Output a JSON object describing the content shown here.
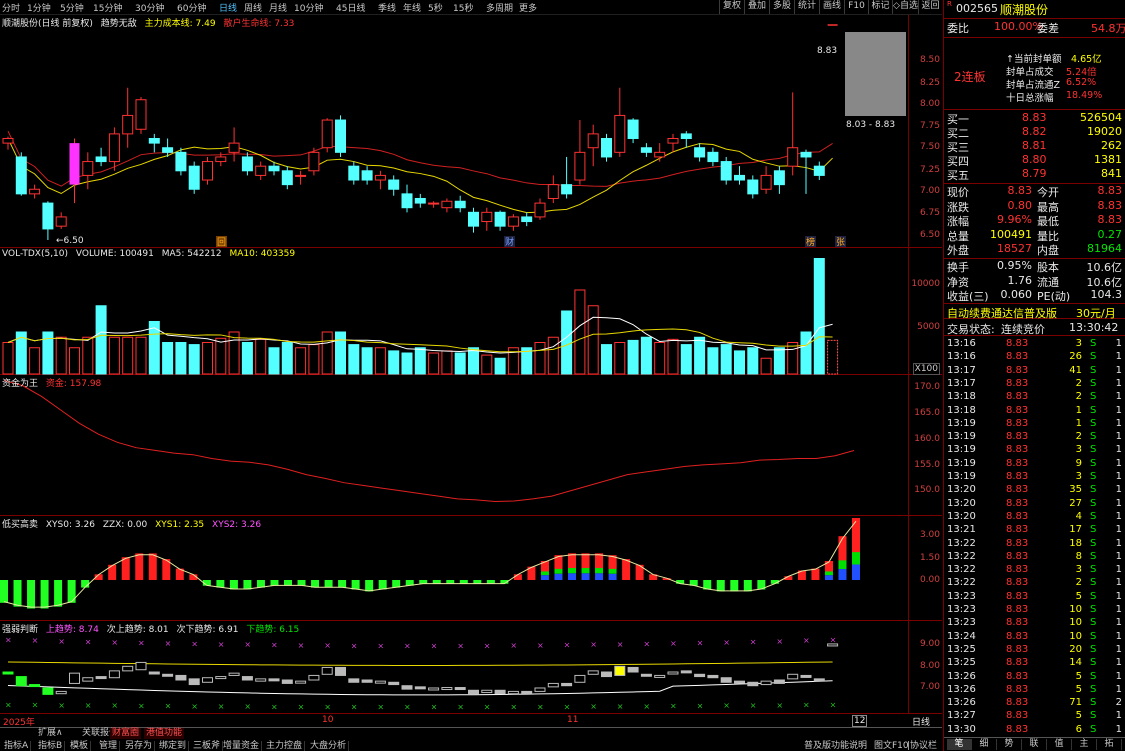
{
  "topbar": {
    "periods": [
      "分时",
      "1分钟",
      "5分钟",
      "15分钟",
      "30分钟",
      "60分钟",
      "日线",
      "周线",
      "月线",
      "10分钟",
      "45日线",
      "季线",
      "年线",
      "5秒",
      "15秒",
      "多周期",
      "更多"
    ],
    "active_period": "日线",
    "buttons": [
      "复权",
      "叠加",
      "多股",
      "统计",
      "画线",
      "F10",
      "标记",
      "◇自选",
      "返回"
    ]
  },
  "main": {
    "title": "顺潮股份(日线 前复权)",
    "indicator": "趋势无敌",
    "cost_line": "主力成本线: 7.49",
    "breakeven": "散户生命线: 7.33",
    "y_labels": [
      "8.50",
      "8.25",
      "8.00",
      "7.75",
      "7.50",
      "7.25",
      "7.00",
      "6.75",
      "6.50"
    ],
    "low_label": "6.50",
    "high_label": "8.83",
    "range_label": "8.03 - 8.83",
    "markers": [
      "回",
      "财",
      "榜",
      "张"
    ]
  },
  "volume": {
    "title": "VOL-TDX(5,10)",
    "volume": "VOLUME: 100491",
    "ma5": "MA5: 542212",
    "ma10": "MA10: 403359",
    "y_labels": [
      "10000",
      "5000"
    ],
    "unit": "X100"
  },
  "fund": {
    "title": "资金为王",
    "value": "资金: 157.98",
    "y_labels": [
      "170.0",
      "165.0",
      "160.0",
      "155.0",
      "150.0"
    ]
  },
  "lowbuy": {
    "title": "低买高卖",
    "xys0": "XYS0: 3.26",
    "zzx": "ZZX: 0.00",
    "xys1": "XYS1: 2.35",
    "xys2": "XYS2: 3.26",
    "y_labels": [
      "3.00",
      "1.50",
      "0.00"
    ]
  },
  "strength": {
    "title": "强弱判断",
    "up": "上趋势: 8.74",
    "next_up": "次上趋势: 8.01",
    "next_down": "次下趋势: 6.91",
    "down": "下趋势: 6.15",
    "y_labels": [
      "9.00",
      "8.00",
      "7.00"
    ]
  },
  "xaxis": {
    "labels": [
      "2025年",
      "10",
      "11",
      "12"
    ],
    "period": "日线"
  },
  "bottombar": {
    "tabs_top": [
      "扩展∧",
      "关联报价",
      "财富圈",
      "港值功能"
    ],
    "tabs": [
      "指标A",
      "指标B",
      "模板",
      "管理",
      "另存为",
      "绑定到",
      "三板斧",
      "增量资金",
      "主力控盘",
      "大盘分析"
    ],
    "right_tabs": [
      "普及版功能说明",
      "图文F10",
      "|协议栏"
    ]
  },
  "side": {
    "code": "002565",
    "name": "顺潮股份",
    "ratio_label": "委比",
    "ratio": "100.00%",
    "diff_label": "委差",
    "diff": "54.8万",
    "board": "2连板",
    "seal_lines": [
      {
        "label": "↑当前封单额",
        "value": "4.65亿"
      },
      {
        "label": "封单占成交",
        "value": "5.24倍"
      },
      {
        "label": "封单占流通Z",
        "value": "6.52%"
      },
      {
        "label": "十日总涨幅",
        "value": "18.49%"
      }
    ],
    "bids": [
      {
        "label": "买一",
        "price": "8.83",
        "vol": "526504"
      },
      {
        "label": "买二",
        "price": "8.82",
        "vol": "19020"
      },
      {
        "label": "买三",
        "price": "8.81",
        "vol": "262"
      },
      {
        "label": "买四",
        "price": "8.80",
        "vol": "1381"
      },
      {
        "label": "买五",
        "price": "8.79",
        "vol": "841"
      }
    ],
    "quote": [
      {
        "l1": "现价",
        "v1": "8.83",
        "l2": "今开",
        "v2": "8.83"
      },
      {
        "l1": "涨跌",
        "v1": "0.80",
        "l2": "最高",
        "v2": "8.83"
      },
      {
        "l1": "涨幅",
        "v1": "9.96%",
        "l2": "最低",
        "v2": "8.83"
      },
      {
        "l1": "总量",
        "v1": "100491",
        "l2": "量比",
        "v2": "0.27"
      },
      {
        "l1": "外盘",
        "v1": "18527",
        "l2": "内盘",
        "v2": "81964"
      }
    ],
    "stats": [
      {
        "l1": "换手",
        "v1": "0.95%",
        "l2": "股本",
        "v2": "10.6亿"
      },
      {
        "l1": "净资",
        "v1": "1.76",
        "l2": "流通",
        "v2": "10.6亿"
      },
      {
        "l1": "收益(三)",
        "v1": "0.060",
        "l2": "PE(动)",
        "v2": "104.3"
      }
    ],
    "promo": "自动续费通达信普及版",
    "price_tag": "30元/月",
    "trade_status_label": "交易状态:",
    "trade_status": "连续竞价",
    "trade_time": "13:30:42",
    "ticks": [
      [
        "13:16",
        "8.83",
        "3",
        "S",
        "1"
      ],
      [
        "13:16",
        "8.83",
        "26",
        "S",
        "1"
      ],
      [
        "13:17",
        "8.83",
        "41",
        "S",
        "1"
      ],
      [
        "13:17",
        "8.83",
        "2",
        "S",
        "1"
      ],
      [
        "13:18",
        "8.83",
        "2",
        "S",
        "1"
      ],
      [
        "13:18",
        "8.83",
        "1",
        "S",
        "1"
      ],
      [
        "13:19",
        "8.83",
        "1",
        "S",
        "1"
      ],
      [
        "13:19",
        "8.83",
        "2",
        "S",
        "1"
      ],
      [
        "13:19",
        "8.83",
        "3",
        "S",
        "1"
      ],
      [
        "13:19",
        "8.83",
        "9",
        "S",
        "1"
      ],
      [
        "13:19",
        "8.83",
        "3",
        "S",
        "1"
      ],
      [
        "13:20",
        "8.83",
        "35",
        "S",
        "1"
      ],
      [
        "13:20",
        "8.83",
        "27",
        "S",
        "1"
      ],
      [
        "13:20",
        "8.83",
        "4",
        "S",
        "1"
      ],
      [
        "13:21",
        "8.83",
        "17",
        "S",
        "1"
      ],
      [
        "13:22",
        "8.83",
        "18",
        "S",
        "1"
      ],
      [
        "13:22",
        "8.83",
        "8",
        "S",
        "1"
      ],
      [
        "13:22",
        "8.83",
        "3",
        "S",
        "1"
      ],
      [
        "13:22",
        "8.83",
        "2",
        "S",
        "1"
      ],
      [
        "13:23",
        "8.83",
        "5",
        "S",
        "1"
      ],
      [
        "13:23",
        "8.83",
        "10",
        "S",
        "1"
      ],
      [
        "13:23",
        "8.83",
        "10",
        "S",
        "1"
      ],
      [
        "13:24",
        "8.83",
        "10",
        "S",
        "1"
      ],
      [
        "13:25",
        "8.83",
        "20",
        "S",
        "1"
      ],
      [
        "13:25",
        "8.83",
        "14",
        "S",
        "1"
      ],
      [
        "13:26",
        "8.83",
        "5",
        "S",
        "1"
      ],
      [
        "13:26",
        "8.83",
        "5",
        "S",
        "1"
      ],
      [
        "13:26",
        "8.83",
        "71",
        "S",
        "2"
      ],
      [
        "13:27",
        "8.83",
        "5",
        "S",
        "1"
      ],
      [
        "13:30",
        "8.83",
        "6",
        "S",
        "1"
      ]
    ],
    "bottom_tabs": [
      "笔",
      "细",
      "势",
      "联",
      "值",
      "主",
      "拓"
    ]
  },
  "colors": {
    "up": "#ff3232",
    "down": "#54ffff",
    "panel_border": "#7a0000",
    "bg": "#000000",
    "ma_white": "#ffffff",
    "ma_yellow": "#ffff00"
  },
  "chart_data": {
    "type": "candlestick",
    "ylim": [
      6.5,
      8.83
    ],
    "candles": [
      [
        7.55,
        7.6,
        7.48,
        7.62
      ],
      [
        7.4,
        7.0,
        6.98,
        7.45
      ],
      [
        7.0,
        7.05,
        6.95,
        7.1
      ],
      [
        6.9,
        6.62,
        6.5,
        6.92
      ],
      [
        6.65,
        6.75,
        6.62,
        6.8
      ],
      [
        7.1,
        7.55,
        6.9,
        7.6
      ],
      [
        7.2,
        7.35,
        7.05,
        7.45
      ],
      [
        7.4,
        7.35,
        7.3,
        7.5
      ],
      [
        7.35,
        7.65,
        7.25,
        7.72
      ],
      [
        7.65,
        7.85,
        7.5,
        8.15
      ],
      [
        7.7,
        8.02,
        7.65,
        8.05
      ],
      [
        7.6,
        7.55,
        7.45,
        7.65
      ],
      [
        7.5,
        7.45,
        7.4,
        7.6
      ],
      [
        7.45,
        7.25,
        7.2,
        7.5
      ],
      [
        7.3,
        7.05,
        7.0,
        7.35
      ],
      [
        7.15,
        7.35,
        7.1,
        7.4
      ],
      [
        7.35,
        7.4,
        7.3,
        7.45
      ],
      [
        7.45,
        7.55,
        7.35,
        7.72
      ],
      [
        7.4,
        7.25,
        7.2,
        7.45
      ],
      [
        7.2,
        7.3,
        7.15,
        7.35
      ],
      [
        7.3,
        7.25,
        7.2,
        7.35
      ],
      [
        7.25,
        7.1,
        7.05,
        7.3
      ],
      [
        7.2,
        7.2,
        7.1,
        7.25
      ],
      [
        7.25,
        7.45,
        7.2,
        7.5
      ],
      [
        7.5,
        7.8,
        7.45,
        7.82
      ],
      [
        7.8,
        7.45,
        7.4,
        7.85
      ],
      [
        7.3,
        7.15,
        7.1,
        7.35
      ],
      [
        7.25,
        7.15,
        7.1,
        7.3
      ],
      [
        7.15,
        7.2,
        7.05,
        7.25
      ],
      [
        7.15,
        7.05,
        6.98,
        7.2
      ],
      [
        7.0,
        6.85,
        6.8,
        7.1
      ],
      [
        6.95,
        6.9,
        6.85,
        7.0
      ],
      [
        6.9,
        6.9,
        6.85,
        6.92
      ],
      [
        6.85,
        6.92,
        6.8,
        6.95
      ],
      [
        6.92,
        6.85,
        6.8,
        6.98
      ],
      [
        6.8,
        6.65,
        6.58,
        6.85
      ],
      [
        6.7,
        6.8,
        6.6,
        6.85
      ],
      [
        6.8,
        6.65,
        6.6,
        6.82
      ],
      [
        6.65,
        6.75,
        6.6,
        6.78
      ],
      [
        6.75,
        6.7,
        6.65,
        6.8
      ],
      [
        6.75,
        6.9,
        6.72,
        6.95
      ],
      [
        6.95,
        7.1,
        6.9,
        7.2
      ],
      [
        7.1,
        7.0,
        6.95,
        7.4
      ],
      [
        7.15,
        7.45,
        7.1,
        7.8
      ],
      [
        7.5,
        7.65,
        7.3,
        7.75
      ],
      [
        7.6,
        7.4,
        7.35,
        7.65
      ],
      [
        7.45,
        7.85,
        7.4,
        8.15
      ],
      [
        7.8,
        7.6,
        7.55,
        7.82
      ],
      [
        7.5,
        7.45,
        7.4,
        7.55
      ],
      [
        7.4,
        7.45,
        7.35,
        7.55
      ],
      [
        7.55,
        7.6,
        7.45,
        7.65
      ],
      [
        7.65,
        7.6,
        7.5,
        7.68
      ],
      [
        7.5,
        7.4,
        7.35,
        7.55
      ],
      [
        7.45,
        7.35,
        7.3,
        7.5
      ],
      [
        7.35,
        7.15,
        7.1,
        7.4
      ],
      [
        7.2,
        7.15,
        7.1,
        7.3
      ],
      [
        7.15,
        7.0,
        6.95,
        7.2
      ],
      [
        7.05,
        7.2,
        7.0,
        7.3
      ],
      [
        7.25,
        7.1,
        7.0,
        7.3
      ],
      [
        7.3,
        7.5,
        7.2,
        8.1
      ],
      [
        7.45,
        7.4,
        7.0,
        7.48
      ],
      [
        7.3,
        7.2,
        7.15,
        7.35
      ],
      [
        8.83,
        8.83,
        8.83,
        8.83
      ]
    ],
    "volume": [
      3,
      4,
      2.5,
      4,
      3.5,
      2.5,
      3.5,
      6.5,
      3.5,
      3.5,
      3.5,
      5,
      3,
      3,
      2.8,
      3,
      3.4,
      4,
      3,
      3.3,
      2.5,
      3,
      2.5,
      2.8,
      4,
      4,
      2.8,
      2.5,
      2.5,
      2.2,
      2,
      2.5,
      2,
      2.2,
      2,
      2.5,
      1.8,
      1.5,
      2.5,
      2.5,
      3,
      3.5,
      6,
      8,
      6.5,
      2.8,
      3,
      3.2,
      3.5,
      3,
      3.3,
      2.8,
      3.5,
      2.5,
      2.8,
      2.2,
      2.5,
      1.5,
      2.5,
      3,
      4,
      11,
      3.2
    ],
    "fund_line": [
      171,
      170,
      168,
      165.5,
      163,
      161,
      159.5,
      158.5,
      158,
      157.5,
      157.2,
      156.5,
      156,
      155.8,
      155.3,
      154.5,
      153.5,
      152.8,
      152,
      151.5,
      151,
      150.5,
      150,
      149.5,
      149,
      148.8,
      148.5,
      148.6,
      149,
      149.5,
      150.5,
      151.5,
      152.5,
      153.5,
      154,
      154.5,
      155,
      155.3,
      155.5,
      155.7,
      156.2,
      156.3,
      156.5,
      156.5,
      157,
      157.98
    ],
    "lowbuy": [
      -1.2,
      -1.4,
      -1.5,
      -1.5,
      -1.4,
      -1.2,
      -0.4,
      0.3,
      0.8,
      1.2,
      1.4,
      1.4,
      1.1,
      0.6,
      0.3,
      -0.3,
      -0.4,
      -0.5,
      -0.5,
      -0.4,
      -0.3,
      -0.3,
      -0.3,
      -0.4,
      -0.4,
      -0.4,
      -0.5,
      -0.6,
      -0.5,
      -0.4,
      -0.3,
      -0.2,
      -0.2,
      -0.2,
      -0.2,
      -0.2,
      -0.2,
      -0.2,
      0.3,
      0.7,
      1.0,
      1.3,
      1.4,
      1.4,
      1.4,
      1.3,
      1.1,
      0.8,
      0.3,
      0.1,
      -0.2,
      -0.3,
      -0.5,
      -0.6,
      -0.6,
      -0.6,
      -0.5,
      -0.2,
      0.2,
      0.5,
      0.6,
      1.0,
      2.3,
      3.26
    ]
  }
}
